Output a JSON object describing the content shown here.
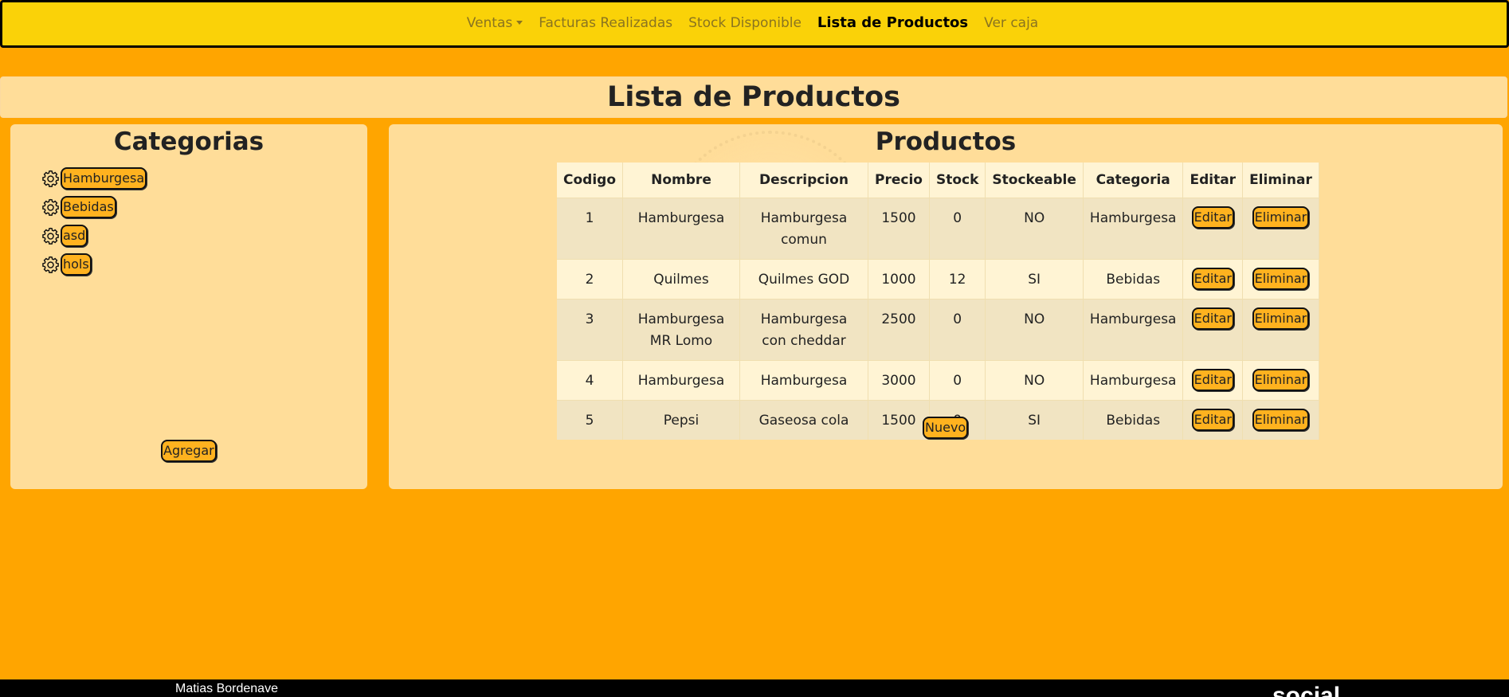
{
  "navbar": {
    "items": [
      {
        "label": "Ventas",
        "dropdown": true
      },
      {
        "label": "Facturas Realizadas"
      },
      {
        "label": "Stock Disponible"
      },
      {
        "label": "Lista de Productos",
        "active": true
      },
      {
        "label": "Ver caja"
      }
    ]
  },
  "page": {
    "title": "Lista de Productos"
  },
  "categorias": {
    "title": "Categorias",
    "items": [
      {
        "label": "Hamburgesa",
        "icon": "gear-icon"
      },
      {
        "label": "Bebidas",
        "icon": "gear-icon"
      },
      {
        "label": "asd",
        "icon": "gear-icon"
      },
      {
        "label": "hols",
        "icon": "gear-icon"
      }
    ],
    "add_label": "Agregar"
  },
  "productos": {
    "title": "Productos",
    "columns": [
      "Codigo",
      "Nombre",
      "Descripcion",
      "Precio",
      "Stock",
      "Stockeable",
      "Categoria",
      "Editar",
      "Eliminar"
    ],
    "rows": [
      {
        "codigo": "1",
        "nombre": "Hamburgesa",
        "descripcion": "Hamburgesa comun",
        "precio": "1500",
        "stock": "0",
        "stockeable": "NO",
        "categoria": "Hamburgesa"
      },
      {
        "codigo": "2",
        "nombre": "Quilmes",
        "descripcion": "Quilmes GOD",
        "precio": "1000",
        "stock": "12",
        "stockeable": "SI",
        "categoria": "Bebidas"
      },
      {
        "codigo": "3",
        "nombre": "Hamburgesa MR Lomo",
        "descripcion": "Hamburgesa con cheddar",
        "precio": "2500",
        "stock": "0",
        "stockeable": "NO",
        "categoria": "Hamburgesa"
      },
      {
        "codigo": "4",
        "nombre": "Hamburgesa",
        "descripcion": "Hamburgesa",
        "precio": "3000",
        "stock": "0",
        "stockeable": "NO",
        "categoria": "Hamburgesa"
      },
      {
        "codigo": "5",
        "nombre": "Pepsi",
        "descripcion": "Gaseosa cola",
        "precio": "1500",
        "stock": "0",
        "stockeable": "SI",
        "categoria": "Bebidas"
      }
    ],
    "edit_label": "Editar",
    "delete_label": "Eliminar",
    "new_label": "Nuevo"
  },
  "footer": {
    "author": "Matias Bordenave",
    "social": "social"
  },
  "colors": {
    "background": "#FFA500",
    "navbar": "#FAD208",
    "card": "#FFDD99",
    "button": "#FFB21F"
  }
}
